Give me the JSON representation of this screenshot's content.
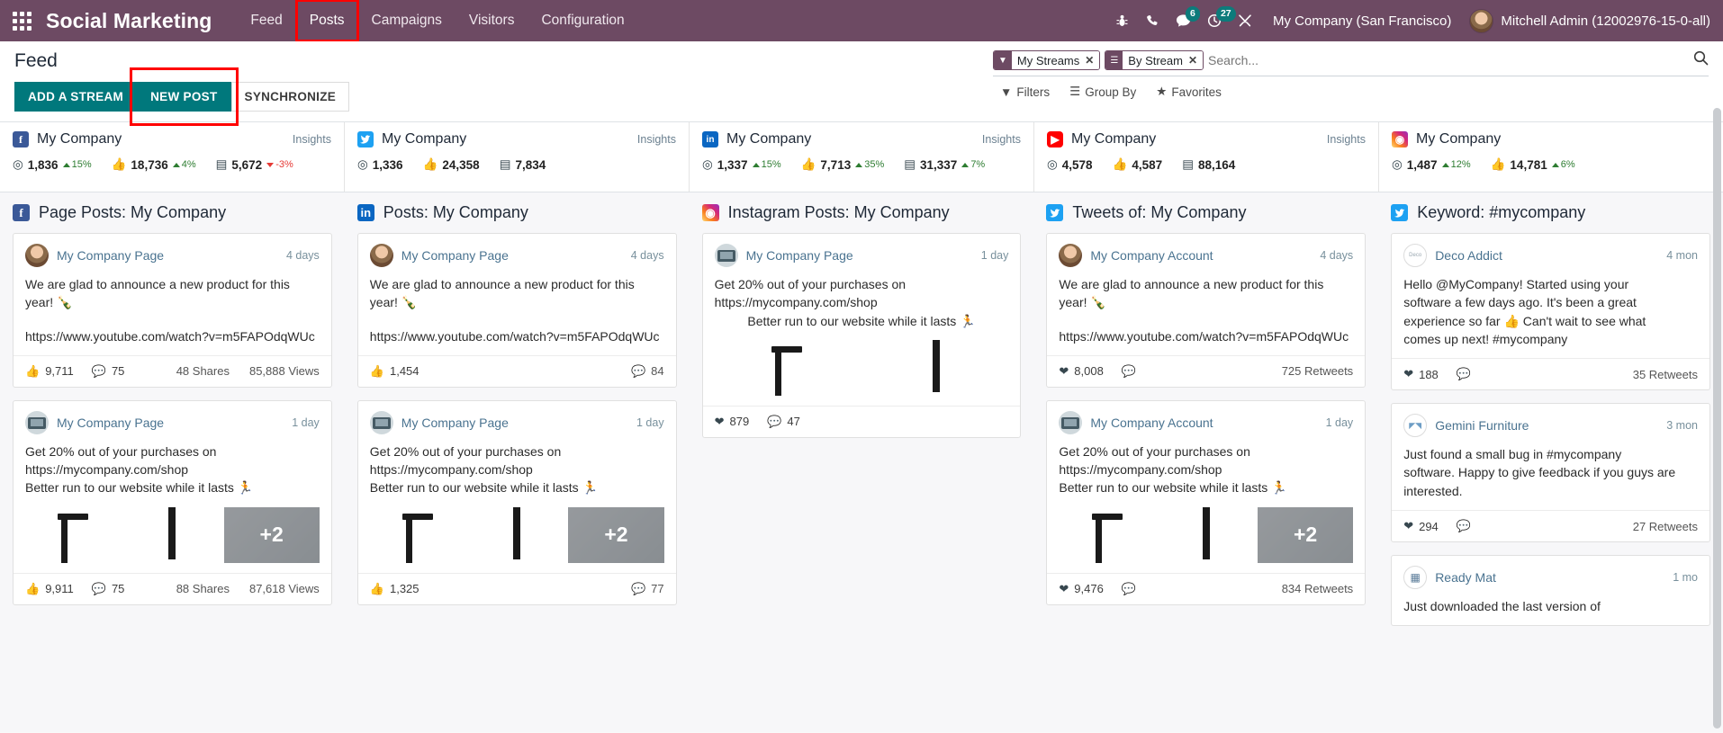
{
  "topbar": {
    "brand": "Social Marketing",
    "apps_icon": "apps-grid-icon",
    "menu": [
      {
        "label": "Feed",
        "highlighted": false
      },
      {
        "label": "Posts",
        "highlighted": true
      },
      {
        "label": "Campaigns",
        "highlighted": false
      },
      {
        "label": "Visitors",
        "highlighted": false
      },
      {
        "label": "Configuration",
        "highlighted": false
      }
    ],
    "icons": [
      {
        "name": "bug-icon",
        "badge": ""
      },
      {
        "name": "phone-icon",
        "badge": ""
      },
      {
        "name": "messages-icon",
        "badge": "6"
      },
      {
        "name": "activities-clock-icon",
        "badge": "27"
      },
      {
        "name": "tools-icon",
        "badge": ""
      }
    ],
    "company": "My Company (San Francisco)",
    "user": "Mitchell Admin (12002976-15-0-all)"
  },
  "control_panel": {
    "title": "Feed",
    "buttons": [
      {
        "label": "ADD A STREAM",
        "style": "primary"
      },
      {
        "label": "NEW POST",
        "style": "primary",
        "highlighted": true
      },
      {
        "label": "SYNCHRONIZE",
        "style": "secondary"
      }
    ],
    "search": {
      "placeholder": "Search...",
      "facets": [
        {
          "icon": "filter-icon",
          "label": "My Streams"
        },
        {
          "icon": "group-by-icon",
          "label": "By Stream"
        }
      ]
    },
    "filters_row": [
      {
        "label": "Filters",
        "icon": "filter-icon"
      },
      {
        "label": "Group By",
        "icon": "group-by-icon"
      },
      {
        "label": "Favorites",
        "icon": "star-icon"
      }
    ]
  },
  "insights": {
    "link_label": "Insights",
    "accounts": [
      {
        "network": "facebook",
        "name": "My Company",
        "has_insights": true,
        "stats": [
          {
            "icon": "audience-icon",
            "value": "1,836",
            "trend": "15%",
            "dir": "up"
          },
          {
            "icon": "engagement-icon",
            "value": "18,736",
            "trend": "4%",
            "dir": "up"
          },
          {
            "icon": "stories-icon",
            "value": "5,672",
            "trend": "-3%",
            "dir": "down"
          }
        ]
      },
      {
        "network": "twitter",
        "name": "My Company",
        "has_insights": true,
        "stats": [
          {
            "icon": "audience-icon",
            "value": "1,336",
            "trend": "",
            "dir": ""
          },
          {
            "icon": "engagement-icon",
            "value": "24,358",
            "trend": "",
            "dir": ""
          },
          {
            "icon": "stories-icon",
            "value": "7,834",
            "trend": "",
            "dir": ""
          }
        ]
      },
      {
        "network": "linkedin",
        "name": "My Company",
        "has_insights": true,
        "stats": [
          {
            "icon": "audience-icon",
            "value": "1,337",
            "trend": "15%",
            "dir": "up"
          },
          {
            "icon": "engagement-icon",
            "value": "7,713",
            "trend": "35%",
            "dir": "up"
          },
          {
            "icon": "stories-icon",
            "value": "31,337",
            "trend": "7%",
            "dir": "up"
          }
        ]
      },
      {
        "network": "youtube",
        "name": "My Company",
        "has_insights": true,
        "stats": [
          {
            "icon": "audience-icon",
            "value": "4,578",
            "trend": "",
            "dir": ""
          },
          {
            "icon": "engagement-icon",
            "value": "4,587",
            "trend": "",
            "dir": ""
          },
          {
            "icon": "stories-icon",
            "value": "88,164",
            "trend": "",
            "dir": ""
          }
        ]
      },
      {
        "network": "instagram",
        "name": "My Company",
        "has_insights": false,
        "stats": [
          {
            "icon": "audience-icon",
            "value": "1,487",
            "trend": "12%",
            "dir": "up"
          },
          {
            "icon": "engagement-icon",
            "value": "14,781",
            "trend": "6%",
            "dir": "up"
          }
        ]
      }
    ]
  },
  "columns": [
    {
      "network": "facebook",
      "title": "Page Posts: My Company",
      "posts": [
        {
          "avatar": "person",
          "author": "My Company Page",
          "when": "4 days",
          "line1": "We are glad to announce a new product for this",
          "line2": "year! 🍾",
          "link": "https://www.youtube.com/watch?v=m5FAPOdqWUc",
          "media": [],
          "engage": {
            "likes": "9,711",
            "comments": "75",
            "shares": "48 Shares",
            "views": "85,888 Views"
          }
        },
        {
          "avatar": "page",
          "author": "My Company Page",
          "when": "1 day",
          "line1": "Get 20% out of your purchases on",
          "line2": "https://mycompany.com/shop",
          "line3": "Better run to our website while it lasts 🏃",
          "media": [
            "chair",
            "post",
            "more+2"
          ],
          "engage": {
            "likes": "9,911",
            "comments": "75",
            "shares": "88 Shares",
            "views": "87,618 Views"
          }
        }
      ]
    },
    {
      "network": "linkedin",
      "title": "Posts: My Company",
      "posts": [
        {
          "avatar": "person",
          "author": "My Company Page",
          "when": "4 days",
          "line1": "We are glad to announce a new product for this",
          "line2": "year! 🍾",
          "link": "https://www.youtube.com/watch?v=m5FAPOdqWUc",
          "media": [],
          "engage": {
            "likes": "1,454",
            "comments": "84",
            "shares": "",
            "views": ""
          }
        },
        {
          "avatar": "page",
          "author": "My Company Page",
          "when": "1 day",
          "line1": "Get 20% out of your purchases on",
          "line2": "https://mycompany.com/shop",
          "line3": "Better run to our website while it lasts 🏃",
          "media": [
            "chair",
            "post",
            "more+2"
          ],
          "engage": {
            "likes": "1,325",
            "comments": "77",
            "shares": "",
            "views": ""
          }
        }
      ]
    },
    {
      "network": "instagram",
      "title": "Instagram Posts: My Company",
      "posts": [
        {
          "avatar": "page",
          "author": "My Company Page",
          "when": "1 day",
          "line1": "Get 20% out of your purchases on",
          "line2": "https://mycompany.com/shop",
          "line3": "Better run to our website while it lasts 🏃",
          "media": [
            "chair",
            "post"
          ],
          "engage": {
            "likes": "879",
            "comments": "47",
            "shares": "",
            "views": ""
          }
        }
      ]
    },
    {
      "network": "twitter",
      "title": "Tweets of: My Company",
      "posts": [
        {
          "avatar": "person",
          "author": "My Company Account",
          "when": "4 days",
          "line1": "We are glad to announce a new product for this",
          "line2": "year! 🍾",
          "link": "https://www.youtube.com/watch?v=m5FAPOdqWUc",
          "media": [],
          "engage": {
            "likes": "8,008",
            "comments": "",
            "shares": "",
            "views": "725 Retweets"
          }
        },
        {
          "avatar": "page",
          "author": "My Company Account",
          "when": "1 day",
          "line1": "Get 20% out of your purchases on",
          "line2": "https://mycompany.com/shop",
          "line3": "Better run to our website while it lasts 🏃",
          "media": [
            "chair",
            "post",
            "more+2"
          ],
          "engage": {
            "likes": "9,476",
            "comments": "",
            "shares": "",
            "views": "834 Retweets"
          }
        }
      ]
    },
    {
      "network": "twitter",
      "title": "Keyword: #mycompany",
      "posts": [
        {
          "avatar": "deco",
          "author": "Deco Addict",
          "when": "4 mon",
          "line1": "Hello @MyCompany! Started using your",
          "line2": "software a few days ago. It's been a great",
          "line3": "experience so far 👍 Can't wait to see what",
          "line4": "comes up next! #mycompany",
          "media": [],
          "engage": {
            "likes": "188",
            "comments": "",
            "shares": "",
            "views": "35 Retweets"
          }
        },
        {
          "avatar": "gem",
          "author": "Gemini Furniture",
          "when": "3 mon",
          "line1": "Just found a small bug in #mycompany",
          "line2": "software. Happy to give feedback if you guys are",
          "line3": "interested.",
          "media": [],
          "engage": {
            "likes": "294",
            "comments": "",
            "shares": "",
            "views": "27 Retweets"
          }
        },
        {
          "avatar": "ready",
          "author": "Ready Mat",
          "when": "1 mo",
          "line1": "Just downloaded the last version of",
          "media": [],
          "engage": {
            "likes": "",
            "comments": "",
            "shares": "",
            "views": ""
          }
        }
      ]
    }
  ],
  "colors": {
    "topbar": "#6d4a63",
    "primary": "#00787c",
    "highlight": "#ff0000",
    "up": "#2e7d32",
    "down": "#e53935"
  }
}
